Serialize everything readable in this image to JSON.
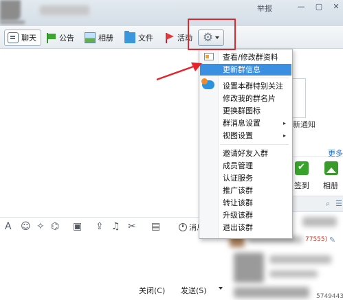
{
  "window": {
    "report_link": "举报",
    "min_icon": "minimize-icon",
    "max_icon": "maximize-icon",
    "close_icon": "close-icon"
  },
  "toolbar": {
    "items": [
      {
        "label": "聊天",
        "icon": "chat-icon"
      },
      {
        "label": "公告",
        "icon": "notice-flag-icon"
      },
      {
        "label": "相册",
        "icon": "album-icon"
      },
      {
        "label": "文件",
        "icon": "folder-icon"
      },
      {
        "label": "活动",
        "icon": "activity-flag-icon"
      }
    ],
    "settings_icon": "gear-icon"
  },
  "menu": {
    "items": [
      {
        "label": "查看/修改群资料"
      },
      {
        "label": "更新群信息",
        "state": "highlighted"
      },
      {
        "label": "设置本群特别关注"
      },
      {
        "label": "修改我的群名片"
      },
      {
        "label": "更换群图标"
      },
      {
        "label": "群消息设置",
        "submenu": true
      },
      {
        "label": "视图设置",
        "submenu": true
      },
      {
        "label": "邀请好友入群"
      },
      {
        "label": "成员管理"
      },
      {
        "label": "认证服务"
      },
      {
        "label": "推广该群"
      },
      {
        "label": "转让该群"
      },
      {
        "label": "升级该群"
      },
      {
        "label": "退出该群"
      }
    ],
    "submenu_glyph": "▸"
  },
  "side_panel": {
    "new_notice": "新通知",
    "more_link": "更多",
    "checkin_label": "签到",
    "album_label": "相册",
    "member_id_1": "77555)",
    "member_id_2": "5749443"
  },
  "input_toolbar": {
    "icons": [
      "font-icon",
      "emoji-icon",
      "magic-icon",
      "shake-icon",
      "image-icon",
      "upload-icon",
      "music-icon",
      "screenshot-icon",
      "more-icon"
    ],
    "history_label": "消息"
  },
  "footer": {
    "close_label": "关闭(C)",
    "send_label": "发送(S)"
  },
  "colors": {
    "highlight_box": "#e3242b",
    "menu_active": "#3b8fe0",
    "link_blue": "#2a6fc9"
  }
}
